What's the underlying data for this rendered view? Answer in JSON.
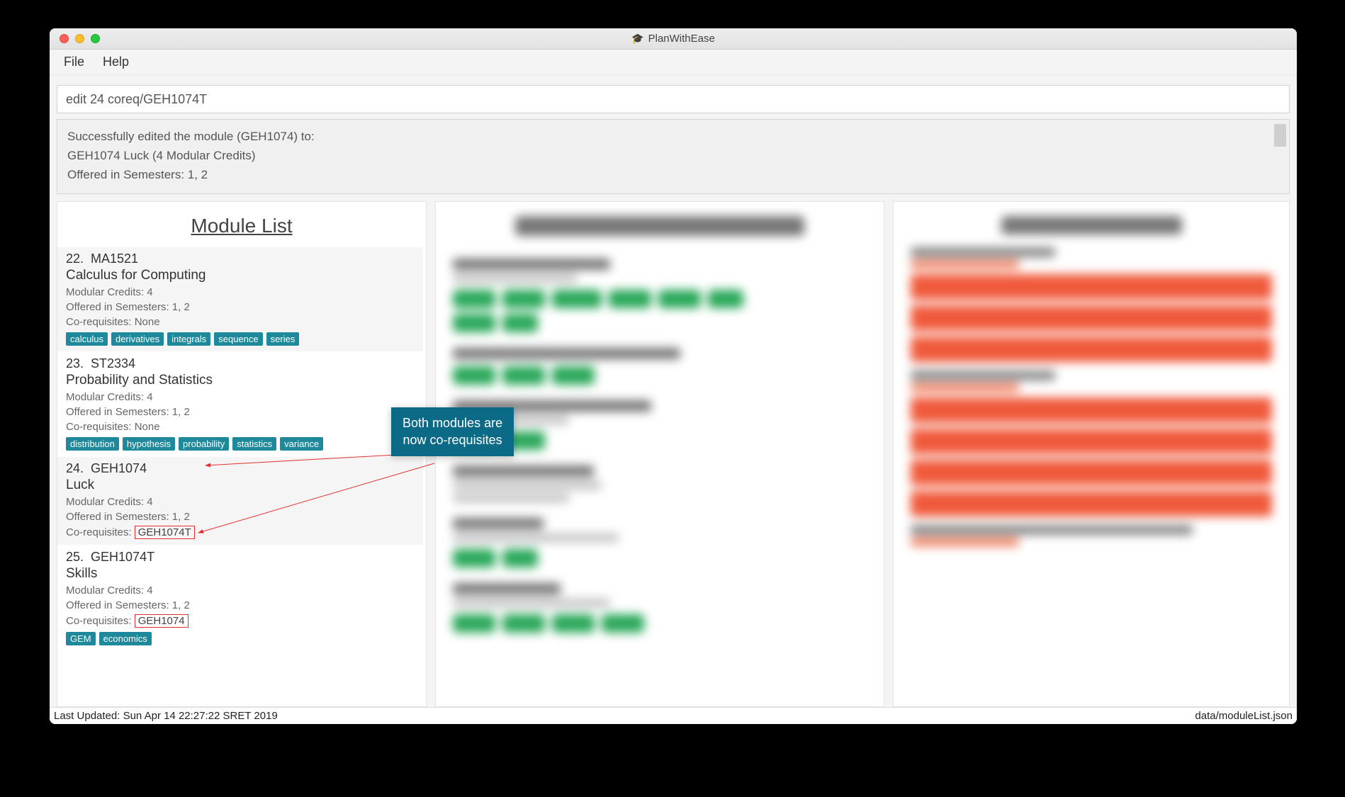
{
  "window": {
    "title": "PlanWithEase"
  },
  "menu": {
    "file": "File",
    "help": "Help"
  },
  "command": {
    "value": "edit 24 coreq/GEH1074T"
  },
  "result": {
    "line1": "Successfully edited the module (GEH1074) to:",
    "line2": "GEH1074 Luck (4 Modular Credits)",
    "line3": "Offered in Semesters: 1, 2"
  },
  "columns": {
    "module_list_title": "Module List"
  },
  "modules": [
    {
      "idx": "22.",
      "code": "MA1521",
      "name": "Calculus for Computing",
      "credits": "Modular Credits: 4",
      "sem": "Offered in Semesters: 1, 2",
      "coreq_label": "Co-requisites: ",
      "coreq_value": "None",
      "coreq_boxed": false,
      "tags": [
        "calculus",
        "derivatives",
        "integrals",
        "sequence",
        "series"
      ],
      "alt": true
    },
    {
      "idx": "23.",
      "code": "ST2334",
      "name": "Probability and Statistics",
      "credits": "Modular Credits: 4",
      "sem": "Offered in Semesters: 1, 2",
      "coreq_label": "Co-requisites: ",
      "coreq_value": "None",
      "coreq_boxed": false,
      "tags": [
        "distribution",
        "hypothesis",
        "probability",
        "statistics",
        "variance"
      ],
      "alt": false
    },
    {
      "idx": "24.",
      "code": "GEH1074",
      "name": "Luck",
      "credits": "Modular Credits: 4",
      "sem": "Offered in Semesters: 1, 2",
      "coreq_label": "Co-requisites: ",
      "coreq_value": "GEH1074T",
      "coreq_boxed": true,
      "tags": [],
      "alt": true
    },
    {
      "idx": "25.",
      "code": "GEH1074T",
      "name": "Skills",
      "credits": "Modular Credits: 4",
      "sem": "Offered in Semesters: 1, 2",
      "coreq_label": "Co-requisites: ",
      "coreq_value": "GEH1074",
      "coreq_boxed": true,
      "tags": [
        "GEM",
        "economics"
      ],
      "alt": false
    }
  ],
  "callout": {
    "line1": "Both modules are",
    "line2": "now co-requisites"
  },
  "status": {
    "left": "Last Updated: Sun Apr 14 22:27:22 SRET 2019",
    "right": "data/moduleList.json"
  }
}
